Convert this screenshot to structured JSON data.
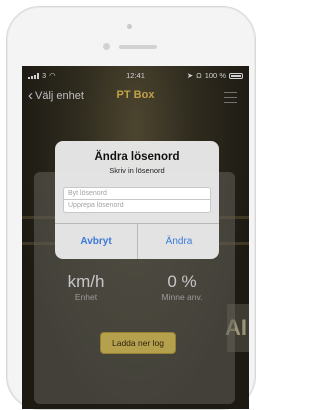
{
  "status": {
    "carrier": "3",
    "time": "12:41",
    "battery": "100 %"
  },
  "nav": {
    "back_label": "Välj enhet",
    "title": "PT Box"
  },
  "readouts": [
    {
      "value": "km/h",
      "label": "Enhet"
    },
    {
      "value": "0 %",
      "label": "Minne anv."
    }
  ],
  "download_button": "Ladda ner log",
  "dialog": {
    "title": "Ändra lösenord",
    "message": "Skriv in lösenord",
    "password_placeholder": "Byt lösenord",
    "repeat_placeholder": "Upprepa lösenord",
    "cancel_label": "Avbryt",
    "ok_label": "Ändra"
  },
  "background_sign": "AI",
  "colors": {
    "accent_title": "#e9c55a",
    "dialog_button": "#3b7ad9",
    "download_button": "#dcc45f"
  }
}
